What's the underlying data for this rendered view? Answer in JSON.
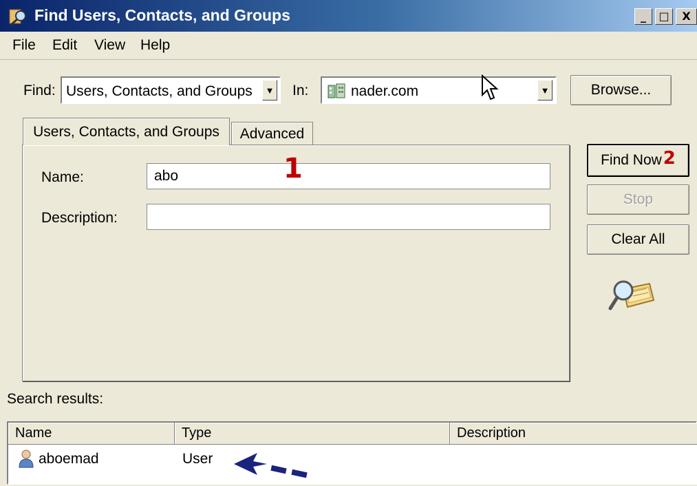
{
  "window": {
    "title": "Find Users, Contacts, and Groups",
    "controls": [
      "_",
      "□",
      "X"
    ]
  },
  "menu": [
    "File",
    "Edit",
    "View",
    "Help"
  ],
  "find": {
    "label": "Find:",
    "value": "Users, Contacts, and Groups",
    "in_label": "In:",
    "in_value": "nader.com",
    "browse_label": "Browse..."
  },
  "tabs": [
    "Users, Contacts, and Groups",
    "Advanced"
  ],
  "form": {
    "name_label": "Name:",
    "name_value": "abo",
    "description_label": "Description:",
    "description_value": ""
  },
  "buttons": {
    "find_now": "Find Now",
    "stop": "Stop",
    "clear_all": "Clear All"
  },
  "annotations": {
    "one": "1",
    "two": "2"
  },
  "results": {
    "label": "Search results:",
    "columns": [
      "Name",
      "Type",
      "Description"
    ],
    "rows": [
      {
        "name": "aboemad",
        "type": "User",
        "description": ""
      }
    ]
  },
  "colors": {
    "titlebar_start": "#0a246a",
    "annotation_red": "#c00000",
    "arrow_blue": "#1a237e"
  }
}
